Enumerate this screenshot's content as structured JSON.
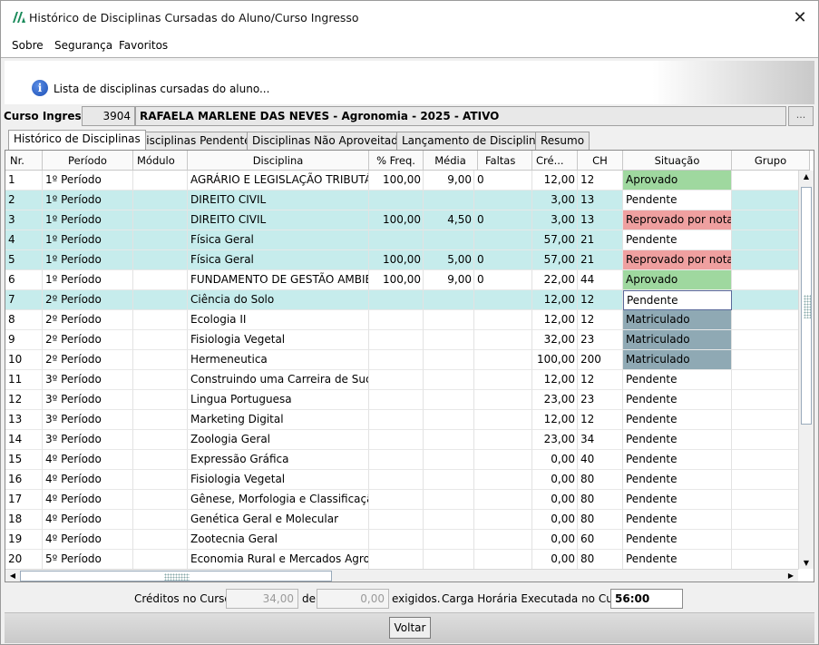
{
  "window": {
    "title": "Histórico de Disciplinas Cursadas do Aluno/Curso Ingresso",
    "close_glyph": "✕"
  },
  "menu": [
    "Sobre",
    "Segurança",
    "Favoritos"
  ],
  "banner": {
    "text": "Lista de disciplinas cursadas do aluno...",
    "icon_glyph": "i"
  },
  "curso": {
    "label": "Curso Ingresso:",
    "code": "3904",
    "name": "RAFAELA MARLENE DAS NEVES - Agronomia - 2025 - ATIVO",
    "lookup_label": "..."
  },
  "tabs": [
    "Histórico de Disciplinas",
    "Disciplinas Pendentes",
    "Disciplinas Não Aproveitadas",
    "Lançamento de Disciplinas",
    "Resumo"
  ],
  "columns": [
    "Nr.",
    "Período",
    "Módulo",
    "Disciplina",
    "% Freq.",
    "Média",
    "Faltas",
    "Cré...",
    "CH",
    "Situação",
    "Grupo"
  ],
  "rows": [
    {
      "nr": "1",
      "periodo": "1º Período",
      "modulo": "",
      "disciplina": "AGRÁRIO E LEGISLAÇÃO TRIBUTÁRIA",
      "freq": "100,00",
      "media": "9,00",
      "faltas": "0",
      "creditos": "12,00",
      "ch": "12",
      "situacao": "Aprovado",
      "grupo": ""
    },
    {
      "nr": "2",
      "periodo": "1º Período",
      "modulo": "",
      "disciplina": "DIREITO CIVIL",
      "freq": "",
      "media": "",
      "faltas": "",
      "creditos": "3,00",
      "ch": "13",
      "situacao": "Pendente",
      "grupo": ""
    },
    {
      "nr": "3",
      "periodo": "1º Período",
      "modulo": "",
      "disciplina": "DIREITO CIVIL",
      "freq": "100,00",
      "media": "4,50",
      "faltas": "0",
      "creditos": "3,00",
      "ch": "13",
      "situacao": "Reprovado por nota",
      "grupo": ""
    },
    {
      "nr": "4",
      "periodo": "1º Período",
      "modulo": "",
      "disciplina": "Física Geral",
      "freq": "",
      "media": "",
      "faltas": "",
      "creditos": "57,00",
      "ch": "21",
      "situacao": "Pendente",
      "grupo": ""
    },
    {
      "nr": "5",
      "periodo": "1º Período",
      "modulo": "",
      "disciplina": "Física Geral",
      "freq": "100,00",
      "media": "5,00",
      "faltas": "0",
      "creditos": "57,00",
      "ch": "21",
      "situacao": "Reprovado por nota",
      "grupo": ""
    },
    {
      "nr": "6",
      "periodo": "1º Período",
      "modulo": "",
      "disciplina": "FUNDAMENTO DE GESTÃO AMBIE...",
      "freq": "100,00",
      "media": "9,00",
      "faltas": "0",
      "creditos": "22,00",
      "ch": "44",
      "situacao": "Aprovado",
      "grupo": ""
    },
    {
      "nr": "7",
      "periodo": "2º Período",
      "modulo": "",
      "disciplina": "Ciência do Solo",
      "freq": "",
      "media": "",
      "faltas": "",
      "creditos": "12,00",
      "ch": "12",
      "situacao": "Pendente",
      "grupo": ""
    },
    {
      "nr": "8",
      "periodo": "2º Período",
      "modulo": "",
      "disciplina": "Ecologia II",
      "freq": "",
      "media": "",
      "faltas": "",
      "creditos": "12,00",
      "ch": "12",
      "situacao": "Matriculado",
      "grupo": ""
    },
    {
      "nr": "9",
      "periodo": "2º Período",
      "modulo": "",
      "disciplina": "Fisiologia Vegetal",
      "freq": "",
      "media": "",
      "faltas": "",
      "creditos": "32,00",
      "ch": "23",
      "situacao": "Matriculado",
      "grupo": ""
    },
    {
      "nr": "10",
      "periodo": "2º Período",
      "modulo": "",
      "disciplina": "Hermeneutica",
      "freq": "",
      "media": "",
      "faltas": "",
      "creditos": "100,00",
      "ch": "200",
      "situacao": "Matriculado",
      "grupo": ""
    },
    {
      "nr": "11",
      "periodo": "3º Período",
      "modulo": "",
      "disciplina": "Construindo uma Carreira de Suces...",
      "freq": "",
      "media": "",
      "faltas": "",
      "creditos": "12,00",
      "ch": "12",
      "situacao": "Pendente",
      "grupo": ""
    },
    {
      "nr": "12",
      "periodo": "3º Período",
      "modulo": "",
      "disciplina": "Lingua Portuguesa",
      "freq": "",
      "media": "",
      "faltas": "",
      "creditos": "23,00",
      "ch": "23",
      "situacao": "Pendente",
      "grupo": ""
    },
    {
      "nr": "13",
      "periodo": "3º Período",
      "modulo": "",
      "disciplina": "Marketing Digital",
      "freq": "",
      "media": "",
      "faltas": "",
      "creditos": "12,00",
      "ch": "12",
      "situacao": "Pendente",
      "grupo": ""
    },
    {
      "nr": "14",
      "periodo": "3º Período",
      "modulo": "",
      "disciplina": "Zoologia Geral",
      "freq": "",
      "media": "",
      "faltas": "",
      "creditos": "23,00",
      "ch": "34",
      "situacao": "Pendente",
      "grupo": ""
    },
    {
      "nr": "15",
      "periodo": "4º Período",
      "modulo": "",
      "disciplina": "Expressão Gráfica",
      "freq": "",
      "media": "",
      "faltas": "",
      "creditos": "0,00",
      "ch": "40",
      "situacao": "Pendente",
      "grupo": ""
    },
    {
      "nr": "16",
      "periodo": "4º Período",
      "modulo": "",
      "disciplina": "Fisiologia Vegetal",
      "freq": "",
      "media": "",
      "faltas": "",
      "creditos": "0,00",
      "ch": "80",
      "situacao": "Pendente",
      "grupo": ""
    },
    {
      "nr": "17",
      "periodo": "4º Período",
      "modulo": "",
      "disciplina": "Gênese, Morfologia e Classificação ...",
      "freq": "",
      "media": "",
      "faltas": "",
      "creditos": "0,00",
      "ch": "80",
      "situacao": "Pendente",
      "grupo": ""
    },
    {
      "nr": "18",
      "periodo": "4º Período",
      "modulo": "",
      "disciplina": "Genética Geral e Molecular",
      "freq": "",
      "media": "",
      "faltas": "",
      "creditos": "0,00",
      "ch": "80",
      "situacao": "Pendente",
      "grupo": ""
    },
    {
      "nr": "19",
      "periodo": "4º Período",
      "modulo": "",
      "disciplina": "Zootecnia Geral",
      "freq": "",
      "media": "",
      "faltas": "",
      "creditos": "0,00",
      "ch": "60",
      "situacao": "Pendente",
      "grupo": ""
    },
    {
      "nr": "20",
      "periodo": "5º Período",
      "modulo": "",
      "disciplina": "Economia Rural e Mercados Agrop...",
      "freq": "",
      "media": "",
      "faltas": "",
      "creditos": "0,00",
      "ch": "80",
      "situacao": "Pendente",
      "grupo": ""
    }
  ],
  "footer": {
    "creditos_label": "Créditos no Curso:",
    "creditos_value": "34,00",
    "de_label": "de",
    "exigidos_value": "0,00",
    "exigidos_label": "exigidos.",
    "carga_label": "Carga Horária Executada no Curso:",
    "carga_value": "56:00"
  },
  "buttons": {
    "voltar": "Voltar"
  },
  "colors": {
    "row_alt": "#c6ecec",
    "aprovado": "#9fd89f",
    "reprovado": "#efa0a0",
    "matriculado": "#8fa9b4",
    "info_icon": "#1c4fb5"
  }
}
